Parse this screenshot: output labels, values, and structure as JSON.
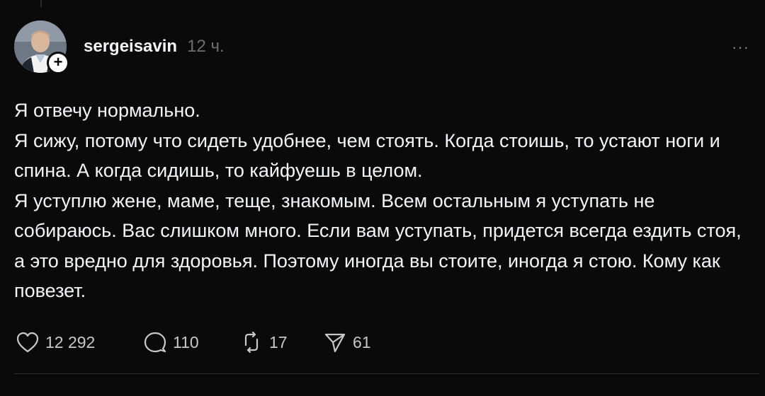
{
  "post": {
    "username": "sergeisavin",
    "time": "12 ч.",
    "more_label": "···",
    "follow_label": "+",
    "lines": [
      "Я отвечу нормально.",
      "Я сижу, потому что сидеть удобнее, чем стоять. Когда стоишь, то устают ноги и спина. А когда сидишь, то кайфуешь в целом.",
      "Я уступлю жене, маме, теще, знакомым. Всем остальным я уступать не собираюсь. Вас слишком много. Если вам уступать, придется всегда ездить стоя, а это вредно для здоровья. Поэтому иногда вы стоите, иногда я стою. Кому как повезет."
    ]
  },
  "actions": {
    "likes": "12 292",
    "replies": "110",
    "reposts": "17",
    "shares": "61",
    "icons": [
      "heart-icon",
      "comment-icon",
      "repost-icon",
      "share-icon"
    ]
  },
  "colors": {
    "background": "#0a0a0a",
    "text": "#f3f5f7",
    "muted": "#6e6e6e",
    "divider": "#2b2b2b"
  }
}
